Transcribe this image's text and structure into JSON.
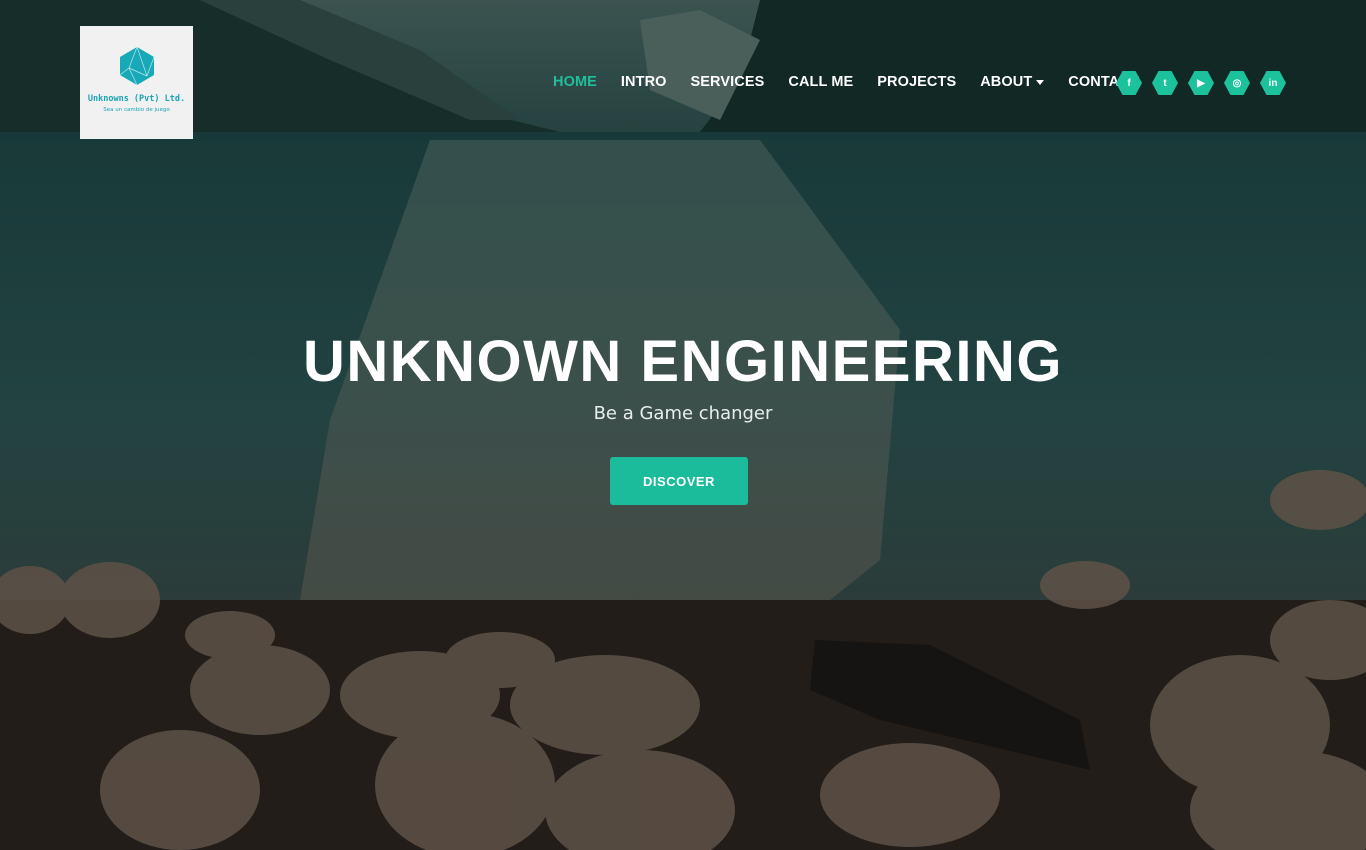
{
  "logo": {
    "name": "Unknowns (Pvt) Ltd.",
    "tagline": "Sea un cambio de juego"
  },
  "nav": {
    "items": [
      {
        "label": "HOME"
      },
      {
        "label": "INTRO"
      },
      {
        "label": "SERVICES"
      },
      {
        "label": "CALL ME"
      },
      {
        "label": "PROJECTS"
      },
      {
        "label": "ABOUT"
      },
      {
        "label": "CONTACT"
      }
    ]
  },
  "social": [
    {
      "icon": "facebook-icon",
      "glyph": "f"
    },
    {
      "icon": "twitter-icon",
      "glyph": "t"
    },
    {
      "icon": "youtube-icon",
      "glyph": "▶"
    },
    {
      "icon": "instagram-icon",
      "glyph": "◎"
    },
    {
      "icon": "linkedin-icon",
      "glyph": "in"
    }
  ],
  "hero": {
    "title": "UNKNOWN ENGINEERING",
    "subtitle": "Be a Game changer",
    "button": "DISCOVER"
  },
  "colors": {
    "accent": "#1abc9c"
  }
}
